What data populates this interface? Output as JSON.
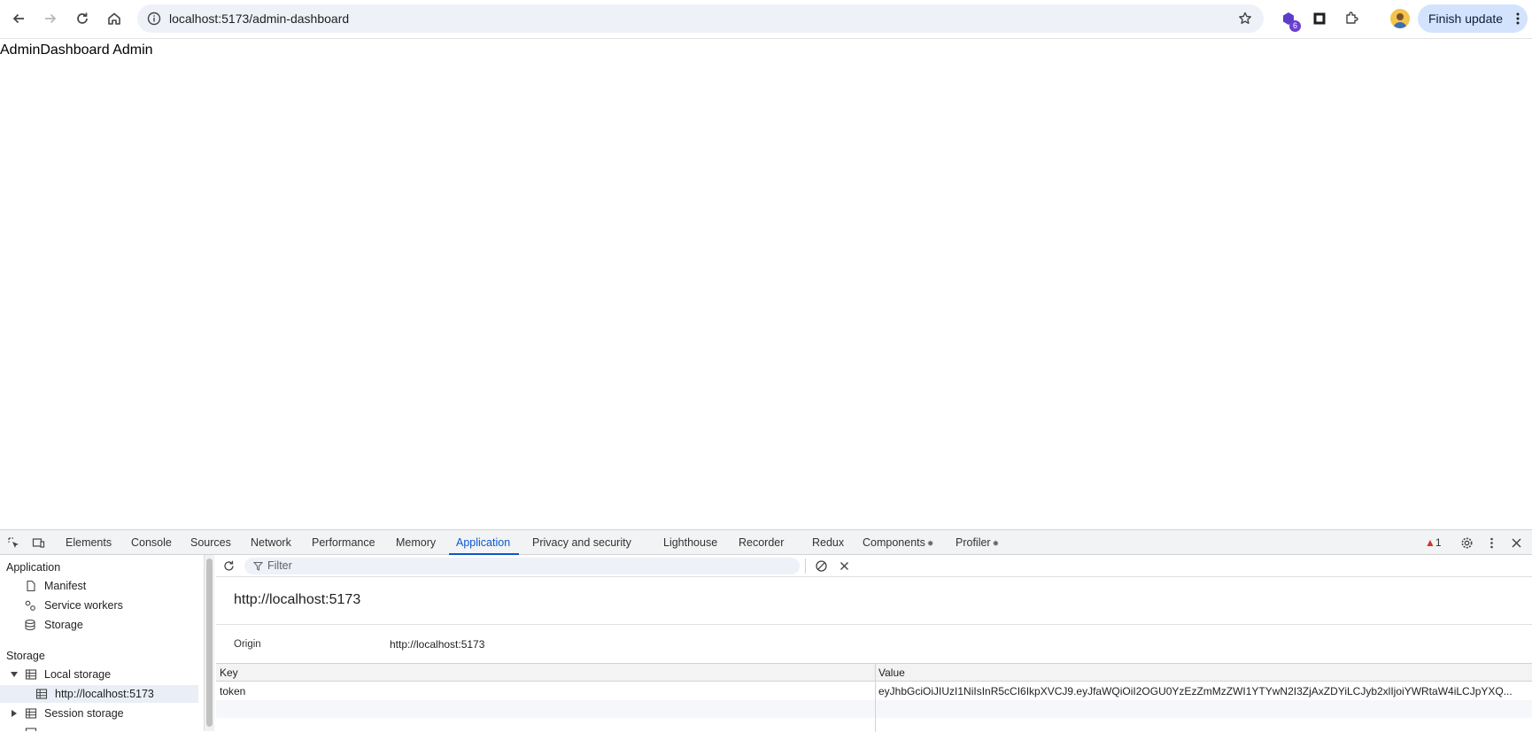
{
  "browser": {
    "url": "localhost:5173/admin-dashboard",
    "extension_badge": "6",
    "finish_update_label": "Finish update"
  },
  "page": {
    "heading": "AdminDashboard Admin"
  },
  "devtools": {
    "tabs": [
      {
        "label": "Elements"
      },
      {
        "label": "Console"
      },
      {
        "label": "Sources"
      },
      {
        "label": "Network"
      },
      {
        "label": "Performance"
      },
      {
        "label": "Memory"
      },
      {
        "label": "Application",
        "active": true
      },
      {
        "label": "Privacy and security"
      },
      {
        "label": "Lighthouse"
      },
      {
        "label": "Recorder"
      },
      {
        "label": "Redux"
      },
      {
        "label": "Components"
      },
      {
        "label": "Profiler"
      }
    ],
    "warning_count": "1",
    "sidebar": {
      "application_section": "Application",
      "manifest": "Manifest",
      "service_workers": "Service workers",
      "storage_item": "Storage",
      "storage_section": "Storage",
      "local_storage": "Local storage",
      "local_storage_origin": "http://localhost:5173",
      "session_storage": "Session storage"
    },
    "main": {
      "filter_placeholder": "Filter",
      "origin_title": "http://localhost:5173",
      "origin_label": "Origin",
      "origin_value": "http://localhost:5173",
      "columns": {
        "key": "Key",
        "value": "Value"
      },
      "rows": [
        {
          "key": "token",
          "value": "eyJhbGciOiJIUzI1NiIsInR5cCI6IkpXVCJ9.eyJfaWQiOiI2OGU0YzEzZmMzZWI1YTYwN2I3ZjAxZDYiLCJyb2xlIjoiYWRtaW4iLCJpYXQ..."
        }
      ]
    }
  }
}
